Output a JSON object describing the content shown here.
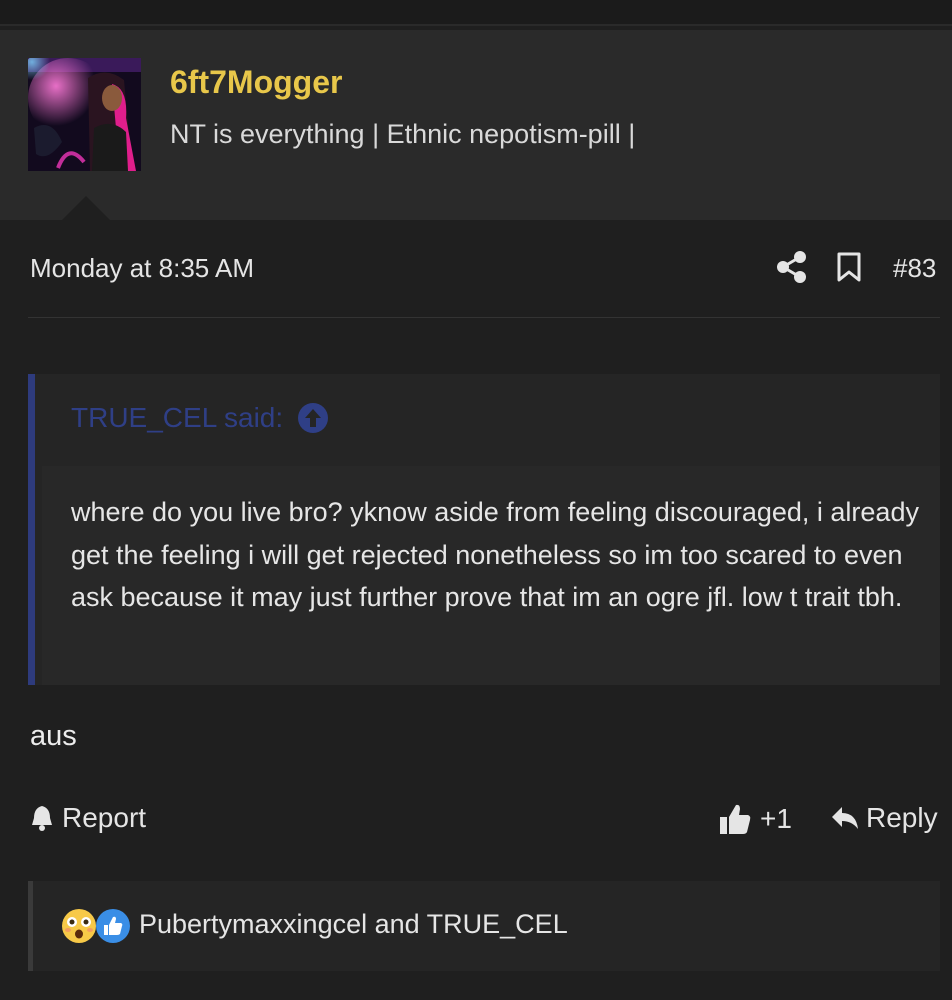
{
  "author": {
    "username": "6ft7Mogger",
    "title": "NT is everything | Ethnic nepotism-pill |"
  },
  "post": {
    "date": "Monday at 8:35 AM",
    "number": "#83",
    "icons": {
      "share": "share-icon",
      "bookmark": "bookmark-icon"
    },
    "quote": {
      "header": "TRUE_CEL said:",
      "icon": "arrow-up-circle-icon",
      "text": "where do you live bro? yknow aside from feeling discouraged, i already get the feeling i will get rejected nonetheless so im too scared to even ask because it may just further prove that im an ogre jfl. low t trait tbh."
    },
    "body": "aus"
  },
  "actions": {
    "report_label": "Report",
    "like_count": "+1",
    "reply_label": "Reply"
  },
  "reactions": {
    "icons": [
      "flushed-emoji-icon",
      "like-reaction-icon"
    ],
    "users": "Pubertymaxxingcel and TRUE_CEL"
  },
  "colors": {
    "background": "#1f1f1f",
    "header_bg": "#2a2a2a",
    "username": "#e8c74a",
    "quote_accent": "#2e3b7d",
    "quote_header": "#2f3f86",
    "like_blue": "#3a8ee6"
  }
}
